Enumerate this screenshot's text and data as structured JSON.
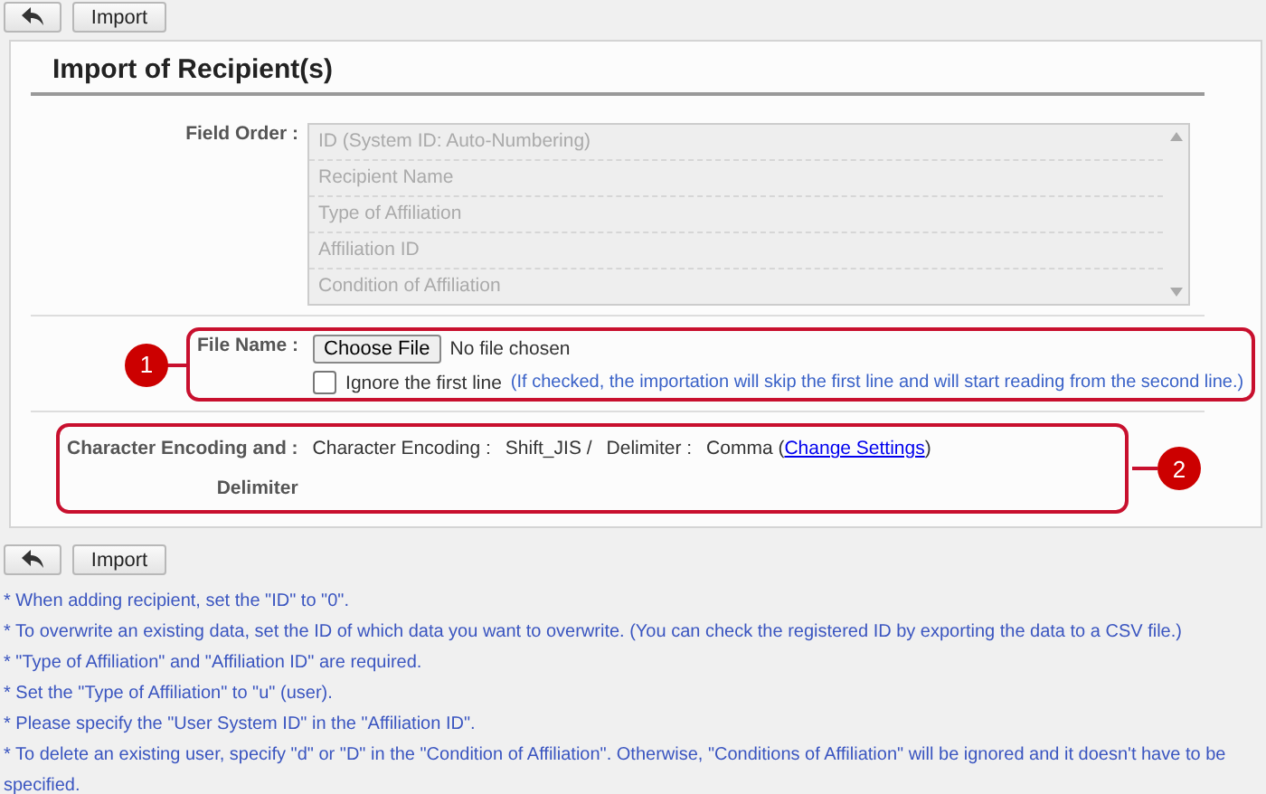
{
  "toolbar_top": {
    "buttons": [
      {
        "kind": "back"
      },
      {
        "kind": "text",
        "label": "Import"
      }
    ]
  },
  "panel": {
    "title": "Import of Recipient(s)",
    "field_order": {
      "label": "Field Order :",
      "items": [
        "ID (System ID: Auto-Numbering)",
        "Recipient Name",
        "Type of Affiliation",
        "Affiliation ID",
        "Condition of Affiliation"
      ]
    },
    "file_name": {
      "label": "File Name :",
      "callout": "1",
      "button": "Choose File",
      "status": "No file chosen",
      "ignore_first_line": {
        "label": "Ignore the first line",
        "checked": false,
        "hint": "(If checked, the importation will skip the first line and will start reading from the second line.)"
      }
    },
    "encoding": {
      "label_lines": [
        "Character Encoding and :",
        "Delimiter"
      ],
      "callout": "2",
      "encoding_label": "Character Encoding :",
      "encoding_value": "Shift_JIS /",
      "delimiter_label": "Delimiter :",
      "delimiter_value": "Comma",
      "link_open": "(",
      "link": "Change Settings",
      "link_close": ")"
    }
  },
  "toolbar_bottom": {
    "buttons": [
      {
        "kind": "back"
      },
      {
        "kind": "text",
        "label": "Import"
      }
    ]
  },
  "notes": [
    "* When adding recipient, set the \"ID\" to \"0\".",
    "* To overwrite an existing data, set the ID of which data you want to overwrite. (You can check the registered ID by exporting the data to a CSV file.)",
    "* \"Type of Affiliation\" and \"Affiliation ID\" are required.",
    "* Set the \"Type of Affiliation\" to \"u\" (user).",
    "* Please specify the \"User System ID\" in the \"Affiliation ID\".",
    "* To delete an existing user, specify \"d\" or \"D\" in the \"Condition of Affiliation\". Otherwise, \"Conditions of Affiliation\" will be ignored and it doesn't have to be specified."
  ]
}
